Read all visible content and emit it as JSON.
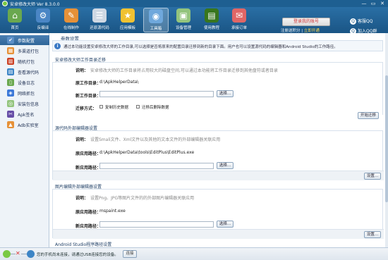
{
  "app": {
    "title": "安卓修改大师 Ver 8.3.0.0"
  },
  "window": {
    "minimize": "—",
    "restore": "▭",
    "close": "✕"
  },
  "toolbar": {
    "tools": [
      {
        "label": "首页",
        "icon": "home-icon",
        "glyph": "⌂",
        "color": "#6aa84f"
      },
      {
        "label": "反编译",
        "icon": "decompile-icon",
        "glyph": "⚙",
        "color": "#4a86c5"
      },
      {
        "label": "在线制作",
        "icon": "online-make-icon",
        "glyph": "✎",
        "color": "#e69138"
      },
      {
        "label": "还原源代码",
        "icon": "restore-source-icon",
        "glyph": "☰",
        "color": "#cfd8e3"
      },
      {
        "label": "应用模板",
        "icon": "app-template-icon",
        "glyph": "★",
        "color": "#f1c232"
      },
      {
        "label": "工具箱",
        "icon": "toolbox-icon",
        "glyph": "◉",
        "color": "#6fa8dc"
      },
      {
        "label": "设备管理",
        "icon": "device-manager-icon",
        "glyph": "▣",
        "color": "#93c47d"
      },
      {
        "label": "使用教程",
        "icon": "tutorial-icon",
        "glyph": "▤",
        "color": "#38761d"
      },
      {
        "label": "承接订单",
        "icon": "orders-icon",
        "glyph": "✉",
        "color": "#e06666"
      }
    ],
    "active_index": 5
  },
  "promo": {
    "button": "登录我的账号",
    "line_prefix": "注册送积分",
    "line_sep": "|",
    "line_highlight": "立即开通"
  },
  "qq": {
    "link1": "客服QQ",
    "link2": "加入QQ群"
  },
  "sidebar": {
    "items": [
      {
        "label": "参数配置",
        "icon": "settings-icon",
        "glyph": "✔",
        "color": "#5b8fc7"
      },
      {
        "label": "多渠道打包",
        "icon": "multichannel-icon",
        "glyph": "▦",
        "color": "#e69138"
      },
      {
        "label": "随机打包",
        "icon": "random-pack-icon",
        "glyph": "▥",
        "color": "#cc4125"
      },
      {
        "label": "查看源代码",
        "icon": "view-source-icon",
        "glyph": "▤",
        "color": "#3d85c6"
      },
      {
        "label": "设备日志",
        "icon": "device-log-icon",
        "glyph": "▯",
        "color": "#6aa84f"
      },
      {
        "label": "网络抓包",
        "icon": "packet-capture-icon",
        "glyph": "◈",
        "color": "#3c78d8"
      },
      {
        "label": "安装包信息",
        "icon": "package-info-icon",
        "glyph": "◎",
        "color": "#93c47d"
      },
      {
        "label": "Apk签名",
        "icon": "apk-sign-icon",
        "glyph": "✂",
        "color": "#674ea7"
      },
      {
        "label": "Adb实验室",
        "icon": "adb-lab-icon",
        "glyph": "▲",
        "color": "#e69138"
      }
    ],
    "active_index": 0
  },
  "main": {
    "title": "参数设置",
    "intro": "通过本功能设置安卓修改大师的工作目录,可以选择是否将原来的配置目录迁移到新的目录下面。用户也可以设置源代码的编辑器和Android Studio的工作路径。",
    "sections": [
      {
        "title": "安卓修改大师工作目录迁移",
        "desc_label": "说明：",
        "desc": "安卓修改大师的工作目录将占用较大的磁盘空间,可以通过本功能将工作目录迁移到其他盘符或者目录",
        "orig_label": "原工作目录：",
        "orig_value": "d:\\ApkHelperData\\",
        "new_label": "新工作目录：",
        "new_value": "",
        "browse": "选择...",
        "mode_label": "迁移方式：",
        "opt1": "复制历史数据",
        "opt2": "迁移后删除数据",
        "action": "开始迁移"
      },
      {
        "title": "源代码外部编辑器设置",
        "desc_label": "说明：",
        "desc": "设置Smali文件、Xml文件以及其他的文本文件的外部编辑器关联应用",
        "orig_label": "原应用路径：",
        "orig_value": "d:\\ApkHelperData\\tools\\EditPlus\\EditPlus.exe",
        "new_label": "新应用路径：",
        "new_value": "",
        "browse": "选择...",
        "action": "设置..."
      },
      {
        "title": "图片编辑外部编辑器设置",
        "desc_label": "说明：",
        "desc": "设置Png、JPG等图片文件的的外部图片编辑器关联应用",
        "orig_label": "原应用路径：",
        "orig_value": "mspaint.exe",
        "new_label": "新应用路径：",
        "new_value": "",
        "browse": "选择...",
        "action": "设置..."
      },
      {
        "title": "Android Studio程序路径设置"
      }
    ]
  },
  "status": {
    "text": "您的手机尚未连接，请通过USB连接您的设备。",
    "button": "连接"
  }
}
